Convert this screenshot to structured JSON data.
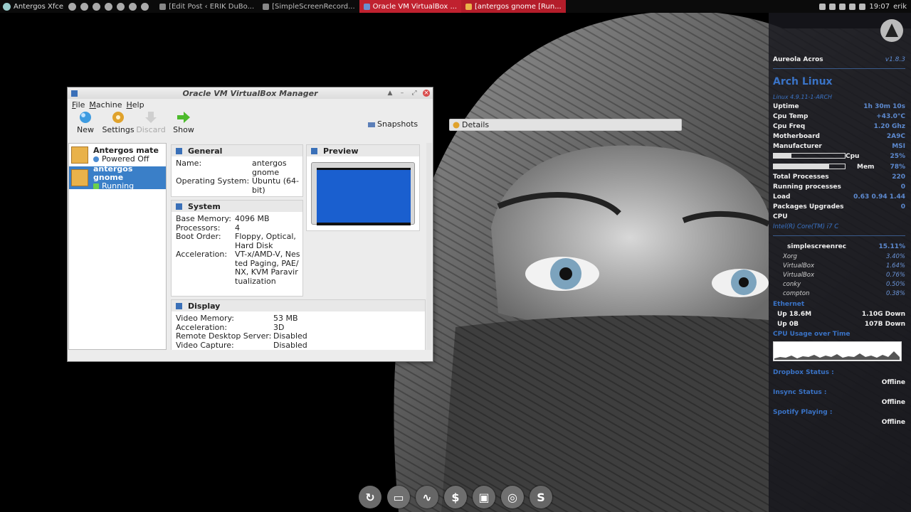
{
  "top_panel": {
    "menu_label": "Antergos Xfce",
    "tasks": [
      {
        "label": "[Edit Post ‹ ERIK DuBo..."
      },
      {
        "label": "[SimpleScreenRecord..."
      },
      {
        "label": "Oracle VM VirtualBox ..."
      },
      {
        "label": "[antergos gnome [Run..."
      }
    ],
    "clock": "19:07",
    "user": "erik"
  },
  "vbox": {
    "title": "Oracle VM VirtualBox Manager",
    "menu": [
      "File",
      "Machine",
      "Help"
    ],
    "toolbar": {
      "new": "New",
      "settings": "Settings",
      "discard": "Discard",
      "show": "Show"
    },
    "details_label": "Details",
    "snapshots_label": "Snapshots",
    "vms": [
      {
        "name": "Antergos mate",
        "state": "Powered Off"
      },
      {
        "name": "antergos gnome",
        "state": "Running"
      }
    ],
    "general": {
      "header": "General",
      "name_label": "Name:",
      "name_value": "antergos gnome",
      "os_label": "Operating System:",
      "os_value": "Ubuntu (64-bit)"
    },
    "preview": {
      "header": "Preview"
    },
    "system": {
      "header": "System",
      "rows": [
        {
          "k": "Base Memory:",
          "v": "4096 MB"
        },
        {
          "k": "Processors:",
          "v": "4"
        },
        {
          "k": "Boot Order:",
          "v": "Floppy, Optical, Hard Disk"
        },
        {
          "k": "Acceleration:",
          "v": "VT-x/AMD-V, Nested Paging, PAE/NX, KVM Paravirtualization"
        }
      ]
    },
    "display": {
      "header": "Display",
      "rows": [
        {
          "k": "Video Memory:",
          "v": "53 MB"
        },
        {
          "k": "Acceleration:",
          "v": "3D"
        },
        {
          "k": "Remote Desktop Server:",
          "v": "Disabled"
        },
        {
          "k": "Video Capture:",
          "v": "Disabled"
        }
      ]
    }
  },
  "conky": {
    "theme": "Aureola Acros",
    "version": "v1.8.3",
    "distro": "Arch Linux",
    "kernel": "Linux 4.9.11-1-ARCH",
    "rows": [
      {
        "k": "Uptime",
        "v": "1h 30m 10s"
      },
      {
        "k": "Cpu Temp",
        "v": "+43.0°C"
      },
      {
        "k": "Cpu Freq",
        "v": "1.20 Ghz"
      },
      {
        "k": "Motherboard",
        "v": "2A9C"
      },
      {
        "k": "Manufacturer",
        "v": "MSI"
      }
    ],
    "cpu_bar": {
      "label": "Cpu",
      "value": "25%",
      "fraction": 0.25
    },
    "mem_bar": {
      "label": "Mem",
      "value": "78%",
      "fraction": 0.78
    },
    "rows2": [
      {
        "k": "Total Processes",
        "v": "220"
      },
      {
        "k": "Running processes",
        "v": "0"
      },
      {
        "k": "Load",
        "v": "0.63 0.94 1.44"
      },
      {
        "k": "Packages Upgrades",
        "v": "0"
      }
    ],
    "cpu_label": "CPU",
    "cpu_model": "Intel(R) Core(TM) i7 C",
    "top_proc": {
      "name": "simplescreenrec",
      "value": "15.11%"
    },
    "procs": [
      {
        "name": "Xorg",
        "value": "3.40%"
      },
      {
        "name": "VirtualBox",
        "value": "1.64%"
      },
      {
        "name": "VirtualBox",
        "value": "0.76%"
      },
      {
        "name": "conky",
        "value": "0.50%"
      },
      {
        "name": "compton",
        "value": "0.38%"
      }
    ],
    "ethernet_label": "Ethernet",
    "net": [
      {
        "up": "Up 18.6M",
        "down": "1.10G Down"
      },
      {
        "up": "Up 0B",
        "down": "107B Down"
      }
    ],
    "cpu_graph_label": "CPU Usage over Time",
    "dropbox_label": "Dropbox Status :",
    "dropbox_value": "Offline",
    "insync_label": "Insync Status :",
    "insync_value": "Offline",
    "spotify_label": "Spotify Playing :",
    "spotify_value": "Offline"
  },
  "dock": {
    "icons": [
      "refresh-icon",
      "files-icon",
      "waveform-icon",
      "dollar-icon",
      "image-viewer-icon",
      "screenshot-icon",
      "skype-icon"
    ]
  }
}
